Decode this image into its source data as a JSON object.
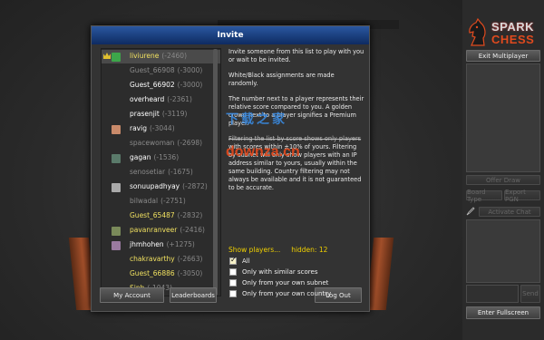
{
  "modal": {
    "title": "Invite",
    "players": [
      {
        "name": "liviurene",
        "rating": "(-2460)",
        "color": "yellow",
        "crown": true,
        "avatar": "#3da64a",
        "selected": true
      },
      {
        "name": "Guest_66908",
        "rating": "(-3000)",
        "color": "gray"
      },
      {
        "name": "Guest_66902",
        "rating": "(-3000)",
        "color": "white"
      },
      {
        "name": "overheard",
        "rating": "(-2361)",
        "color": "white"
      },
      {
        "name": "prasenjit",
        "rating": "(-3119)",
        "color": "white"
      },
      {
        "name": "ravig",
        "rating": "(-3044)",
        "color": "white",
        "avatar": "#c98a6a"
      },
      {
        "name": "spacewoman",
        "rating": "(-2698)",
        "color": "gray"
      },
      {
        "name": "gagan",
        "rating": "(-1536)",
        "color": "white",
        "avatar": "#5a7a6a"
      },
      {
        "name": "senosetiar",
        "rating": "(-1675)",
        "color": "gray"
      },
      {
        "name": "sonuupadhyay",
        "rating": "(-2872)",
        "color": "white",
        "avatar": "#aaaaaa"
      },
      {
        "name": "bilwadal",
        "rating": "(-2751)",
        "color": "gray"
      },
      {
        "name": "Guest_65487",
        "rating": "(-2832)",
        "color": "yellow"
      },
      {
        "name": "pavanranveer",
        "rating": "(-2416)",
        "color": "yellow",
        "avatar": "#7a8a5a"
      },
      {
        "name": "jhmhohen",
        "rating": "(+1275)",
        "color": "white",
        "avatar": "#9a7aa0"
      },
      {
        "name": "chakravarthy",
        "rating": "(-2663)",
        "color": "yellow"
      },
      {
        "name": "Guest_66886",
        "rating": "(-3050)",
        "color": "yellow"
      },
      {
        "name": "Sinh",
        "rating": "(-1043)",
        "color": "yellow"
      }
    ],
    "description": {
      "p1": "Invite someone from this list to play with you or wait to be invited.",
      "p2": "White/Black assignments are made randomly.",
      "p3": "The number next to a player represents their relative score compared to you. A golden crown next to a player signifies a Premium player.",
      "p4_strike": "Filtering the list by score shows only players",
      "p4": "with scores within ±10% of yours. Filtering by subnet will only show players with an IP address similar to yours, usually within the same building. Country filtering may not always be available and it is not guaranteed to be accurate."
    },
    "watermark": {
      "line1": "下载之家",
      "line2": "downza.cn"
    },
    "show_players_label": "Show players...",
    "hidden_label": "hidden: 12",
    "filters": [
      {
        "label": "All",
        "checked": true
      },
      {
        "label": "Only with similar scores",
        "checked": false
      },
      {
        "label": "Only from your own subnet",
        "checked": false
      },
      {
        "label": "Only from your own country",
        "checked": false
      }
    ],
    "buttons": {
      "my_account": "My Account",
      "leaderboards": "Leaderboards",
      "log_out": "Log Out"
    }
  },
  "sidebar": {
    "logo": {
      "line1": "SPARK",
      "line2": "CHESS"
    },
    "exit_multiplayer": "Exit Multiplayer",
    "offer_draw": "Offer Draw",
    "board_type": "Board Type",
    "export_pgn": "Export PGN",
    "activate_chat": "Activate Chat",
    "send": "Send",
    "enter_fullscreen": "Enter Fullscreen"
  },
  "colors": {
    "header": "#1c3f80",
    "accent_yellow": "#f0d000",
    "brand_red": "#e04a1e"
  }
}
